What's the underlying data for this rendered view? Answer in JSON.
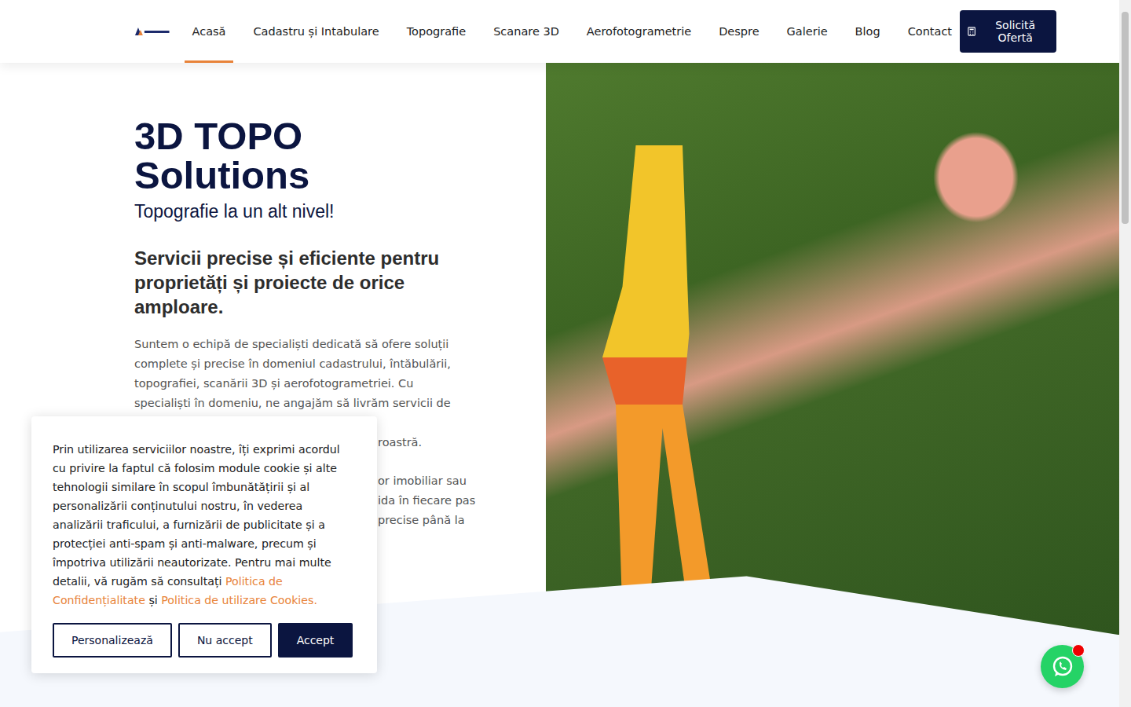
{
  "nav": {
    "items": [
      {
        "label": "Acasă",
        "selected": true
      },
      {
        "label": "Cadastru și Intabulare",
        "selected": false
      },
      {
        "label": "Topografie",
        "selected": false
      },
      {
        "label": "Scanare 3D",
        "selected": false
      },
      {
        "label": "Aerofotogrametrie",
        "selected": false
      },
      {
        "label": "Despre",
        "selected": false
      },
      {
        "label": "Galerie",
        "selected": false
      },
      {
        "label": "Blog",
        "selected": false
      },
      {
        "label": "Contact",
        "selected": false
      }
    ],
    "cta": "Solicită Ofertă"
  },
  "hero": {
    "title": "3D TOPO Solutions",
    "tagline": "Topografie la un alt nivel!",
    "heading": "Servicii precise și eficiente pentru proprietăți și proiecte de orice amploare.",
    "paragraph": "Suntem o echipă de specialiști dedicată să ofere soluții complete și precise în domeniul cadastrului, întăbulării, topografiei, scanării 3D și aerofotogrametriei. Cu specialiști în domeniu, ne angajăm să livrăm servicii de cea mai înaltă",
    "fragments_top": [
      "roastră."
    ],
    "fragments": [
      "or imobiliar sau",
      "ida în fiecare pas",
      "precise până la"
    ]
  },
  "cookie": {
    "text": "Prin utilizarea serviciilor noastre, îți exprimi acordul cu privire la faptul că folosim module cookie și alte tehnologii similare în scopul îmbunătățirii și al personalizării conținutului nostru, în vederea analizării traficului, a furnizării de publicitate și a protecției anti-spam și anti-malware, precum și împotriva utilizării neautorizate. Pentru mai multe detalii, vă rugăm să consultați",
    "link1": "Politica de Confidențialitate",
    "joiner": "și",
    "link2": "Politica de utilizare Cookies.",
    "buttons": [
      {
        "label": "Personalizează",
        "kind": "outline"
      },
      {
        "label": "Nu accept",
        "kind": "outline"
      },
      {
        "label": "Accept",
        "kind": "filled"
      }
    ]
  },
  "chat": {
    "unread": true
  }
}
